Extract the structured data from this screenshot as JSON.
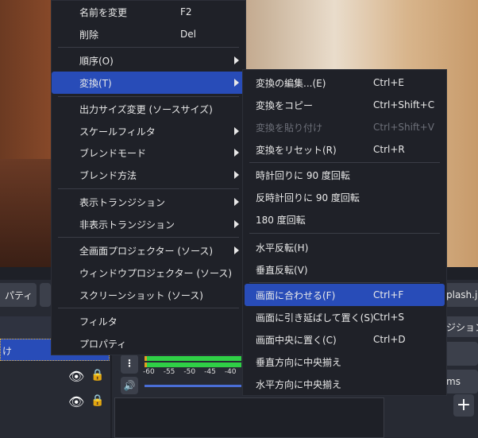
{
  "context_menu": {
    "items": [
      {
        "label": "名前を変更",
        "shortcut": "F2"
      },
      {
        "label": "削除",
        "shortcut": "Del"
      },
      {
        "label": "順序(O)",
        "submenu": true
      },
      {
        "label": "変換(T)",
        "submenu": true,
        "highlighted": true
      },
      {
        "label": "出力サイズ変更 (ソースサイズ)"
      },
      {
        "label": "スケールフィルタ",
        "submenu": true
      },
      {
        "label": "ブレンドモード",
        "submenu": true
      },
      {
        "label": "ブレンド方法",
        "submenu": true
      },
      {
        "label": "表示トランジション",
        "submenu": true
      },
      {
        "label": "非表示トランジション",
        "submenu": true
      },
      {
        "label": "全画面プロジェクター (ソース)",
        "submenu": true
      },
      {
        "label": "ウィンドウプロジェクター (ソース)"
      },
      {
        "label": "スクリーンショット (ソース)"
      },
      {
        "label": "フィルタ"
      },
      {
        "label": "プロパティ"
      }
    ]
  },
  "transform_submenu": {
    "items": [
      {
        "label": "変換の編集...(E)",
        "shortcut": "Ctrl+E"
      },
      {
        "label": "変換をコピー",
        "shortcut": "Ctrl+Shift+C"
      },
      {
        "label": "変換を貼り付け",
        "shortcut": "Ctrl+Shift+V",
        "disabled": true
      },
      {
        "label": "変換をリセット(R)",
        "shortcut": "Ctrl+R"
      },
      {
        "label": "時計回りに 90 度回転"
      },
      {
        "label": "反時計回りに 90 度回転"
      },
      {
        "label": "180 度回転"
      },
      {
        "label": "水平反転(H)"
      },
      {
        "label": "垂直反転(V)"
      },
      {
        "label": "画面に合わせる(F)",
        "shortcut": "Ctrl+F",
        "highlighted": true
      },
      {
        "label": "画面に引き延ばして置く(S)",
        "shortcut": "Ctrl+S"
      },
      {
        "label": "画面中央に置く(C)",
        "shortcut": "Ctrl+D"
      },
      {
        "label": "垂直方向に中央揃え"
      },
      {
        "label": "水平方向に中央揃え"
      }
    ]
  },
  "background": {
    "properties_button": "パティ",
    "source_name": "plash.jp",
    "transition_label": "ジション",
    "item_label": "ms",
    "selected_source": "け",
    "meter_ticks": [
      "-60",
      "-55",
      "-50",
      "-45",
      "-40"
    ]
  },
  "colors": {
    "highlight": "#284cb8",
    "menu_bg": "#1f2128",
    "meter_green": "#2fd046",
    "volume_slider": "#4a6ed6"
  }
}
